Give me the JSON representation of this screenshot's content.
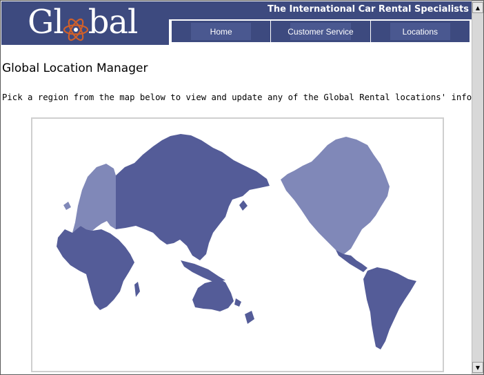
{
  "brand": {
    "logo_left": "Gl",
    "logo_right": "bal",
    "tagline": "The International Car Rental Specialists"
  },
  "nav": {
    "items": [
      {
        "label": "Home"
      },
      {
        "label": "Customer Service"
      },
      {
        "label": "Locations"
      }
    ]
  },
  "main": {
    "title": "Global Location Manager",
    "instructions": "Pick a region from the map below to view and update any of the Global Rental locations' information."
  },
  "map": {
    "regions": [
      {
        "name": "Europe",
        "color": "#8088b8"
      },
      {
        "name": "Asia",
        "color": "#545c98"
      },
      {
        "name": "Africa",
        "color": "#545c98"
      },
      {
        "name": "Australia",
        "color": "#545c98"
      },
      {
        "name": "North America",
        "color": "#8088b8"
      },
      {
        "name": "Central America",
        "color": "#545c98"
      },
      {
        "name": "South America",
        "color": "#545c98"
      }
    ]
  },
  "colors": {
    "brand": "#3d4a7f",
    "atom": "#d0602a"
  }
}
